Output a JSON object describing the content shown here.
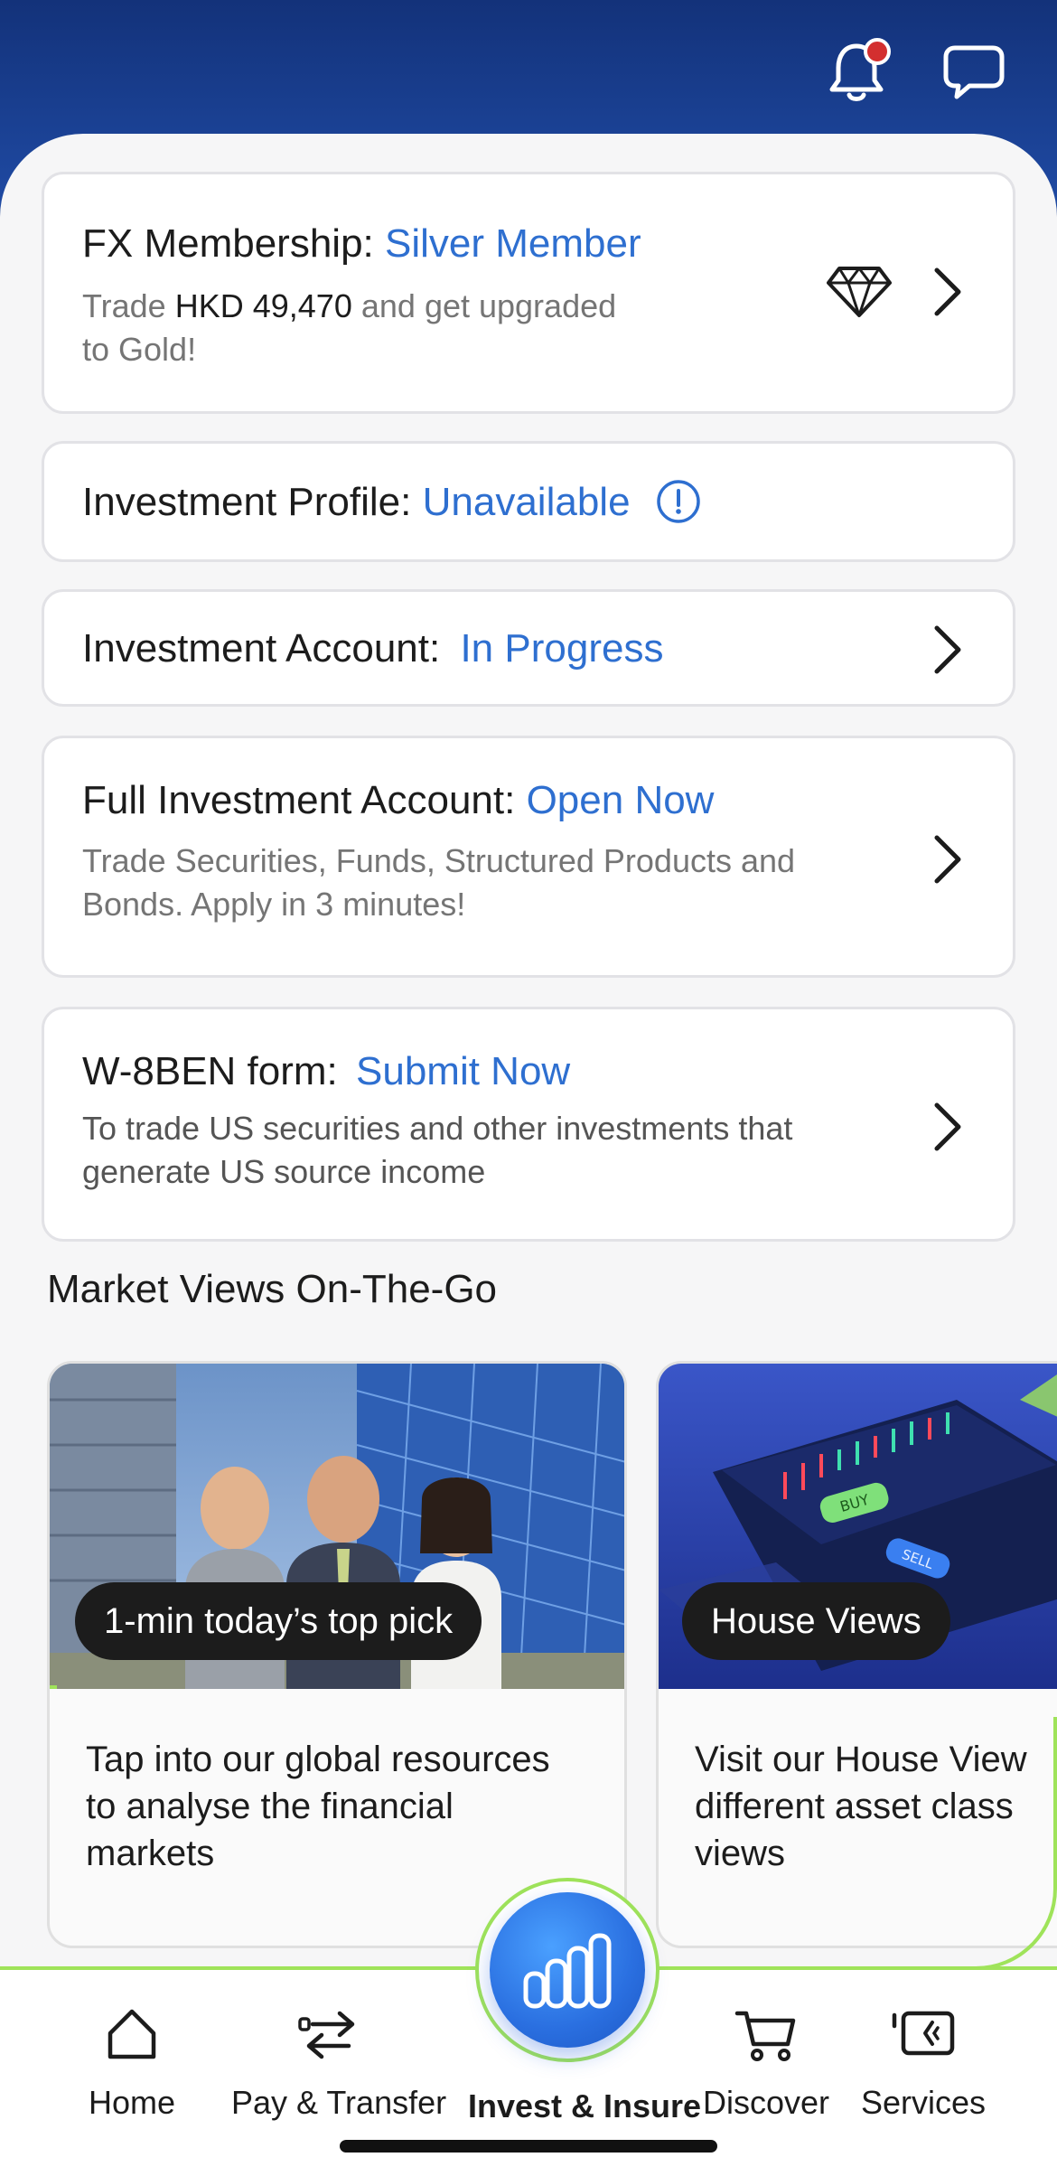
{
  "header": {
    "notification_icon": "bell-icon",
    "chat_icon": "chat-bubble-icon",
    "has_unread_notification": true
  },
  "fx_card": {
    "title_label": "FX Membership:",
    "status": "Silver Member",
    "sub_prefix": "Trade",
    "sub_amount": "HKD 49,470",
    "sub_line1_suffix": "and get upgraded",
    "sub_line2": "to Gold!",
    "icon": "diamond-icon"
  },
  "profile_card": {
    "title_label": "Investment Profile:",
    "status": "Unavailable",
    "icon": "info-circle-icon"
  },
  "account_card": {
    "title_label": "Investment Account:",
    "status": "In Progress"
  },
  "full_account_card": {
    "title_label": "Full Investment Account:",
    "status": "Open Now",
    "sub_line1": "Trade Securities, Funds, Structured Products and",
    "sub_line2": "Bonds. Apply in 3 minutes!"
  },
  "w8ben_card": {
    "title_label": "W-8BEN form:",
    "status": "Submit Now",
    "sub_line1": "To trade US securities and other investments that",
    "sub_line2": "generate US source income"
  },
  "market_views": {
    "title": "Market Views On-The-Go",
    "cards": [
      {
        "pill": "1-min today’s top pick",
        "text_line1": "Tap into our global resources",
        "text_line2": "to analyse the financial",
        "text_line3": "markets"
      },
      {
        "pill": "House Views",
        "text_line1": "Visit our House View",
        "text_line2": "different asset class",
        "text_line3": "views",
        "img_buy": "BUY",
        "img_sell": "SELL"
      }
    ]
  },
  "bottom_nav": {
    "items": [
      {
        "label": "Home",
        "icon": "home-icon"
      },
      {
        "label": "Pay & Transfer",
        "icon": "transfer-arrows-icon"
      },
      {
        "label": "Invest & Insure",
        "icon": "bar-chart-icon",
        "active": true
      },
      {
        "label": "Discover",
        "icon": "shopping-cart-icon"
      },
      {
        "label": "Services",
        "icon": "wallet-card-icon"
      }
    ]
  },
  "colors": {
    "header_blue": "#1a3f8f",
    "accent_blue": "#2e6fd0",
    "active_green": "#9fe35a",
    "notification_red": "#d32f2f"
  }
}
